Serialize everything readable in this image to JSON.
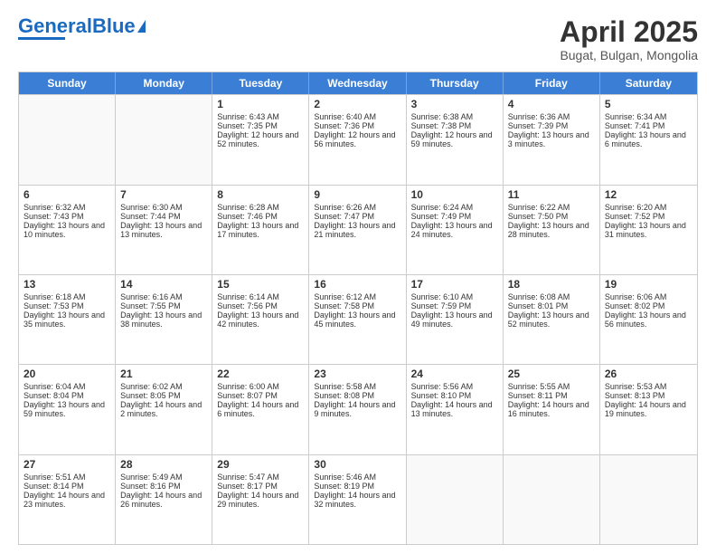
{
  "header": {
    "logo_general": "General",
    "logo_blue": "Blue",
    "title": "April 2025",
    "subtitle": "Bugat, Bulgan, Mongolia"
  },
  "days": [
    "Sunday",
    "Monday",
    "Tuesday",
    "Wednesday",
    "Thursday",
    "Friday",
    "Saturday"
  ],
  "weeks": [
    [
      {
        "day": "",
        "info": ""
      },
      {
        "day": "",
        "info": ""
      },
      {
        "day": "1",
        "info": "Sunrise: 6:43 AM\nSunset: 7:35 PM\nDaylight: 12 hours and 52 minutes."
      },
      {
        "day": "2",
        "info": "Sunrise: 6:40 AM\nSunset: 7:36 PM\nDaylight: 12 hours and 56 minutes."
      },
      {
        "day": "3",
        "info": "Sunrise: 6:38 AM\nSunset: 7:38 PM\nDaylight: 12 hours and 59 minutes."
      },
      {
        "day": "4",
        "info": "Sunrise: 6:36 AM\nSunset: 7:39 PM\nDaylight: 13 hours and 3 minutes."
      },
      {
        "day": "5",
        "info": "Sunrise: 6:34 AM\nSunset: 7:41 PM\nDaylight: 13 hours and 6 minutes."
      }
    ],
    [
      {
        "day": "6",
        "info": "Sunrise: 6:32 AM\nSunset: 7:43 PM\nDaylight: 13 hours and 10 minutes."
      },
      {
        "day": "7",
        "info": "Sunrise: 6:30 AM\nSunset: 7:44 PM\nDaylight: 13 hours and 13 minutes."
      },
      {
        "day": "8",
        "info": "Sunrise: 6:28 AM\nSunset: 7:46 PM\nDaylight: 13 hours and 17 minutes."
      },
      {
        "day": "9",
        "info": "Sunrise: 6:26 AM\nSunset: 7:47 PM\nDaylight: 13 hours and 21 minutes."
      },
      {
        "day": "10",
        "info": "Sunrise: 6:24 AM\nSunset: 7:49 PM\nDaylight: 13 hours and 24 minutes."
      },
      {
        "day": "11",
        "info": "Sunrise: 6:22 AM\nSunset: 7:50 PM\nDaylight: 13 hours and 28 minutes."
      },
      {
        "day": "12",
        "info": "Sunrise: 6:20 AM\nSunset: 7:52 PM\nDaylight: 13 hours and 31 minutes."
      }
    ],
    [
      {
        "day": "13",
        "info": "Sunrise: 6:18 AM\nSunset: 7:53 PM\nDaylight: 13 hours and 35 minutes."
      },
      {
        "day": "14",
        "info": "Sunrise: 6:16 AM\nSunset: 7:55 PM\nDaylight: 13 hours and 38 minutes."
      },
      {
        "day": "15",
        "info": "Sunrise: 6:14 AM\nSunset: 7:56 PM\nDaylight: 13 hours and 42 minutes."
      },
      {
        "day": "16",
        "info": "Sunrise: 6:12 AM\nSunset: 7:58 PM\nDaylight: 13 hours and 45 minutes."
      },
      {
        "day": "17",
        "info": "Sunrise: 6:10 AM\nSunset: 7:59 PM\nDaylight: 13 hours and 49 minutes."
      },
      {
        "day": "18",
        "info": "Sunrise: 6:08 AM\nSunset: 8:01 PM\nDaylight: 13 hours and 52 minutes."
      },
      {
        "day": "19",
        "info": "Sunrise: 6:06 AM\nSunset: 8:02 PM\nDaylight: 13 hours and 56 minutes."
      }
    ],
    [
      {
        "day": "20",
        "info": "Sunrise: 6:04 AM\nSunset: 8:04 PM\nDaylight: 13 hours and 59 minutes."
      },
      {
        "day": "21",
        "info": "Sunrise: 6:02 AM\nSunset: 8:05 PM\nDaylight: 14 hours and 2 minutes."
      },
      {
        "day": "22",
        "info": "Sunrise: 6:00 AM\nSunset: 8:07 PM\nDaylight: 14 hours and 6 minutes."
      },
      {
        "day": "23",
        "info": "Sunrise: 5:58 AM\nSunset: 8:08 PM\nDaylight: 14 hours and 9 minutes."
      },
      {
        "day": "24",
        "info": "Sunrise: 5:56 AM\nSunset: 8:10 PM\nDaylight: 14 hours and 13 minutes."
      },
      {
        "day": "25",
        "info": "Sunrise: 5:55 AM\nSunset: 8:11 PM\nDaylight: 14 hours and 16 minutes."
      },
      {
        "day": "26",
        "info": "Sunrise: 5:53 AM\nSunset: 8:13 PM\nDaylight: 14 hours and 19 minutes."
      }
    ],
    [
      {
        "day": "27",
        "info": "Sunrise: 5:51 AM\nSunset: 8:14 PM\nDaylight: 14 hours and 23 minutes."
      },
      {
        "day": "28",
        "info": "Sunrise: 5:49 AM\nSunset: 8:16 PM\nDaylight: 14 hours and 26 minutes."
      },
      {
        "day": "29",
        "info": "Sunrise: 5:47 AM\nSunset: 8:17 PM\nDaylight: 14 hours and 29 minutes."
      },
      {
        "day": "30",
        "info": "Sunrise: 5:46 AM\nSunset: 8:19 PM\nDaylight: 14 hours and 32 minutes."
      },
      {
        "day": "",
        "info": ""
      },
      {
        "day": "",
        "info": ""
      },
      {
        "day": "",
        "info": ""
      }
    ]
  ]
}
